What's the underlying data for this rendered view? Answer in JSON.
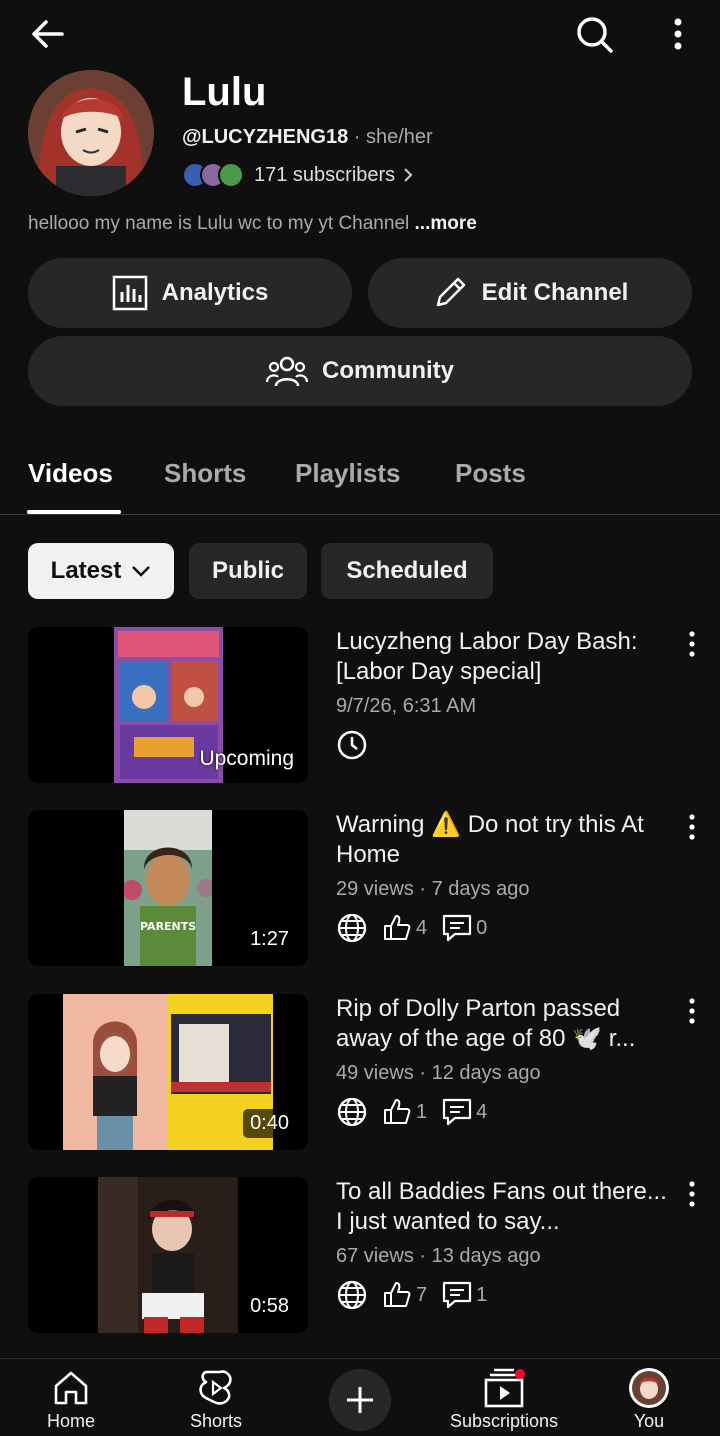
{
  "channel": {
    "name": "Lulu",
    "handle": "@LUCYZHENG18",
    "separator": "·",
    "pronouns": "she/her",
    "subscribers": "171 subscribers",
    "description": "hellooo my name is Lulu wc to my yt Channel",
    "more": "...more"
  },
  "buttons": {
    "analytics": "Analytics",
    "edit_channel": "Edit Channel",
    "community": "Community"
  },
  "tabs": [
    {
      "label": "Videos",
      "active": true
    },
    {
      "label": "Shorts",
      "active": false
    },
    {
      "label": "Playlists",
      "active": false
    },
    {
      "label": "Posts",
      "active": false
    }
  ],
  "filters": [
    {
      "label": "Latest",
      "selected": true
    },
    {
      "label": "Public",
      "selected": false
    },
    {
      "label": "Scheduled",
      "selected": false
    }
  ],
  "videos": [
    {
      "title": "Lucyzheng Labor Day Bash: [Labor Day special]",
      "meta": "9/7/26, 6:31 AM",
      "badge": "Upcoming",
      "status_icon": "clock-icon"
    },
    {
      "title": "Warning ⚠️ Do not try this At Home",
      "meta": "29 views · 7 days ago",
      "duration": "1:27",
      "likes": "4",
      "comments": "0"
    },
    {
      "title": "Rip of Dolly Parton passed away of the age of 80 🕊️ r...",
      "meta": "49 views · 12 days ago",
      "duration": "0:40",
      "likes": "1",
      "comments": "4"
    },
    {
      "title": "To all Baddies Fans out there... I just wanted to say...",
      "meta": "67 views · 13 days ago",
      "duration": "0:58",
      "likes": "7",
      "comments": "1"
    }
  ],
  "nav": {
    "home": "Home",
    "shorts": "Shorts",
    "subscriptions": "Subscriptions",
    "you": "You"
  },
  "colors": {
    "background": "#0f0f0f",
    "button": "#272727",
    "text_secondary": "#aaaaaa",
    "notification_dot": "#ff0033"
  }
}
